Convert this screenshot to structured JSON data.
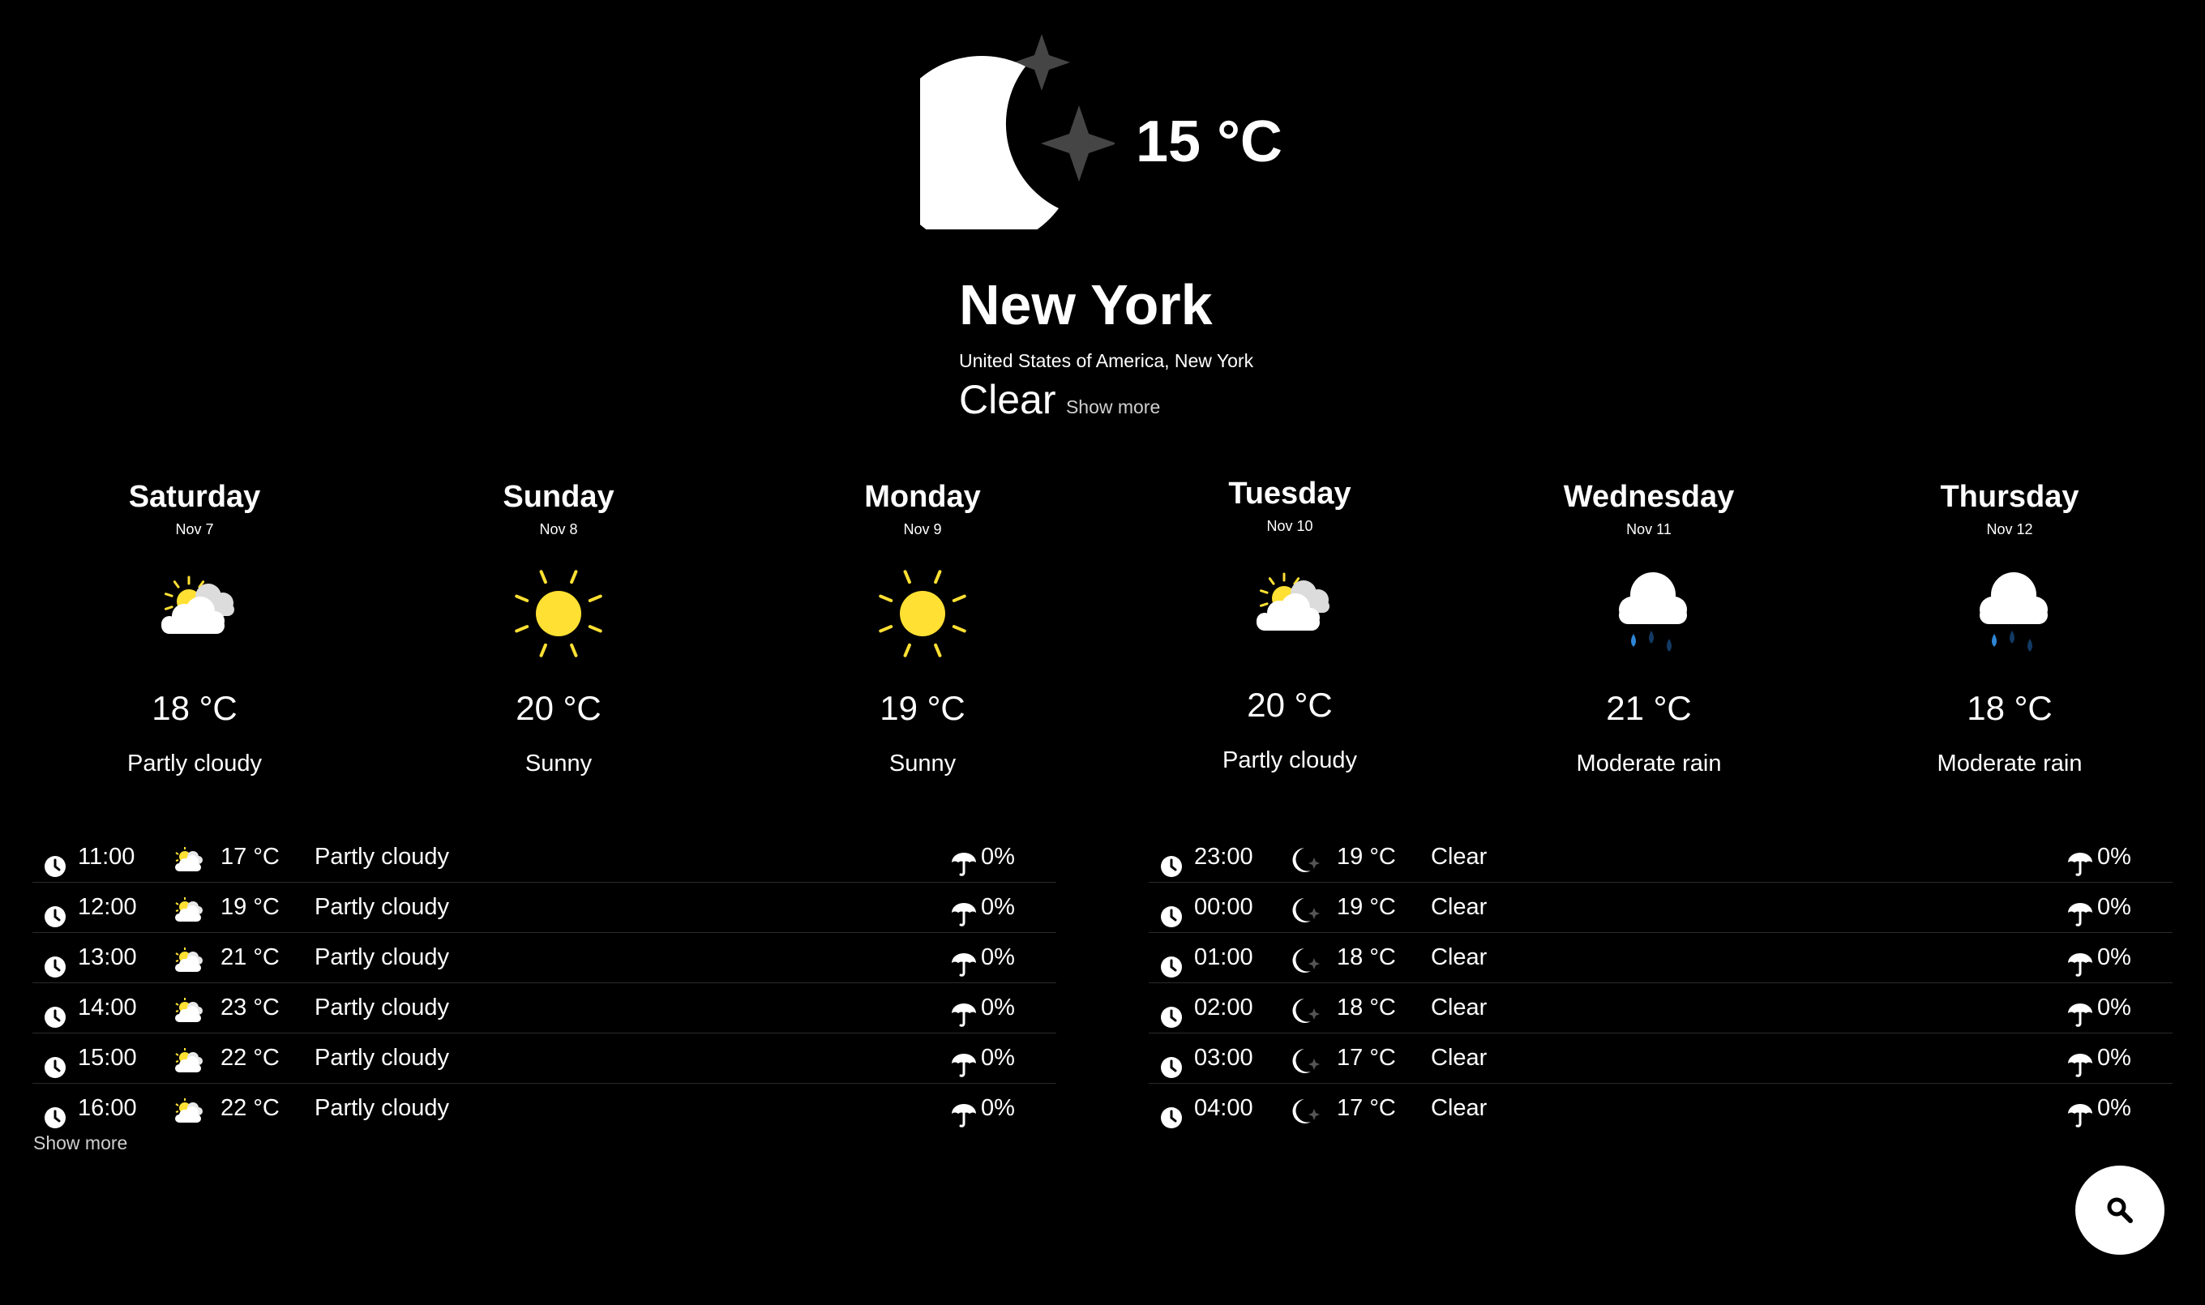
{
  "current": {
    "icon": "moon-stars-icon",
    "temperature": "15 °C",
    "city": "New York",
    "region": "United States of America, New York",
    "condition": "Clear",
    "show_more": "Show more"
  },
  "forecast": [
    {
      "day": "Saturday",
      "date": "Nov 7",
      "icon": "partly-cloudy-icon",
      "temp": "18 °C",
      "condition": "Partly cloudy"
    },
    {
      "day": "Sunday",
      "date": "Nov 8",
      "icon": "sun-icon",
      "temp": "20 °C",
      "condition": "Sunny"
    },
    {
      "day": "Monday",
      "date": "Nov 9",
      "icon": "sun-icon",
      "temp": "19 °C",
      "condition": "Sunny"
    },
    {
      "day": "Tuesday",
      "date": "Nov 10",
      "icon": "partly-cloudy-icon",
      "temp": "20 °C",
      "condition": "Partly cloudy"
    },
    {
      "day": "Wednesday",
      "date": "Nov 11",
      "icon": "rain-cloud-icon",
      "temp": "21 °C",
      "condition": "Moderate rain"
    },
    {
      "day": "Thursday",
      "date": "Nov 12",
      "icon": "rain-cloud-icon",
      "temp": "18 °C",
      "condition": "Moderate rain"
    }
  ],
  "hourly_left": [
    {
      "time": "11:00",
      "icon": "partly-cloudy-icon",
      "temp": "17 °C",
      "condition": "Partly cloudy",
      "precip": "0%"
    },
    {
      "time": "12:00",
      "icon": "partly-cloudy-icon",
      "temp": "19 °C",
      "condition": "Partly cloudy",
      "precip": "0%"
    },
    {
      "time": "13:00",
      "icon": "partly-cloudy-icon",
      "temp": "21 °C",
      "condition": "Partly cloudy",
      "precip": "0%"
    },
    {
      "time": "14:00",
      "icon": "partly-cloudy-icon",
      "temp": "23 °C",
      "condition": "Partly cloudy",
      "precip": "0%"
    },
    {
      "time": "15:00",
      "icon": "partly-cloudy-icon",
      "temp": "22 °C",
      "condition": "Partly cloudy",
      "precip": "0%"
    },
    {
      "time": "16:00",
      "icon": "partly-cloudy-icon",
      "temp": "22 °C",
      "condition": "Partly cloudy",
      "precip": "0%"
    }
  ],
  "hourly_right": [
    {
      "time": "23:00",
      "icon": "moon-icon",
      "temp": "19 °C",
      "condition": "Clear",
      "precip": "0%"
    },
    {
      "time": "00:00",
      "icon": "moon-icon",
      "temp": "19 °C",
      "condition": "Clear",
      "precip": "0%"
    },
    {
      "time": "01:00",
      "icon": "moon-icon",
      "temp": "18 °C",
      "condition": "Clear",
      "precip": "0%"
    },
    {
      "time": "02:00",
      "icon": "moon-icon",
      "temp": "18 °C",
      "condition": "Clear",
      "precip": "0%"
    },
    {
      "time": "03:00",
      "icon": "moon-icon",
      "temp": "17 °C",
      "condition": "Clear",
      "precip": "0%"
    },
    {
      "time": "04:00",
      "icon": "moon-icon",
      "temp": "17 °C",
      "condition": "Clear",
      "precip": "0%"
    }
  ],
  "hourly_show_more": "Show more",
  "search_button": {
    "icon": "search-icon"
  },
  "colors": {
    "background": "#000000",
    "text": "#ffffff",
    "sun": "#ffe033",
    "star": "#454545",
    "rain_light": "#2f86d6",
    "rain_dark": "#123a63"
  }
}
